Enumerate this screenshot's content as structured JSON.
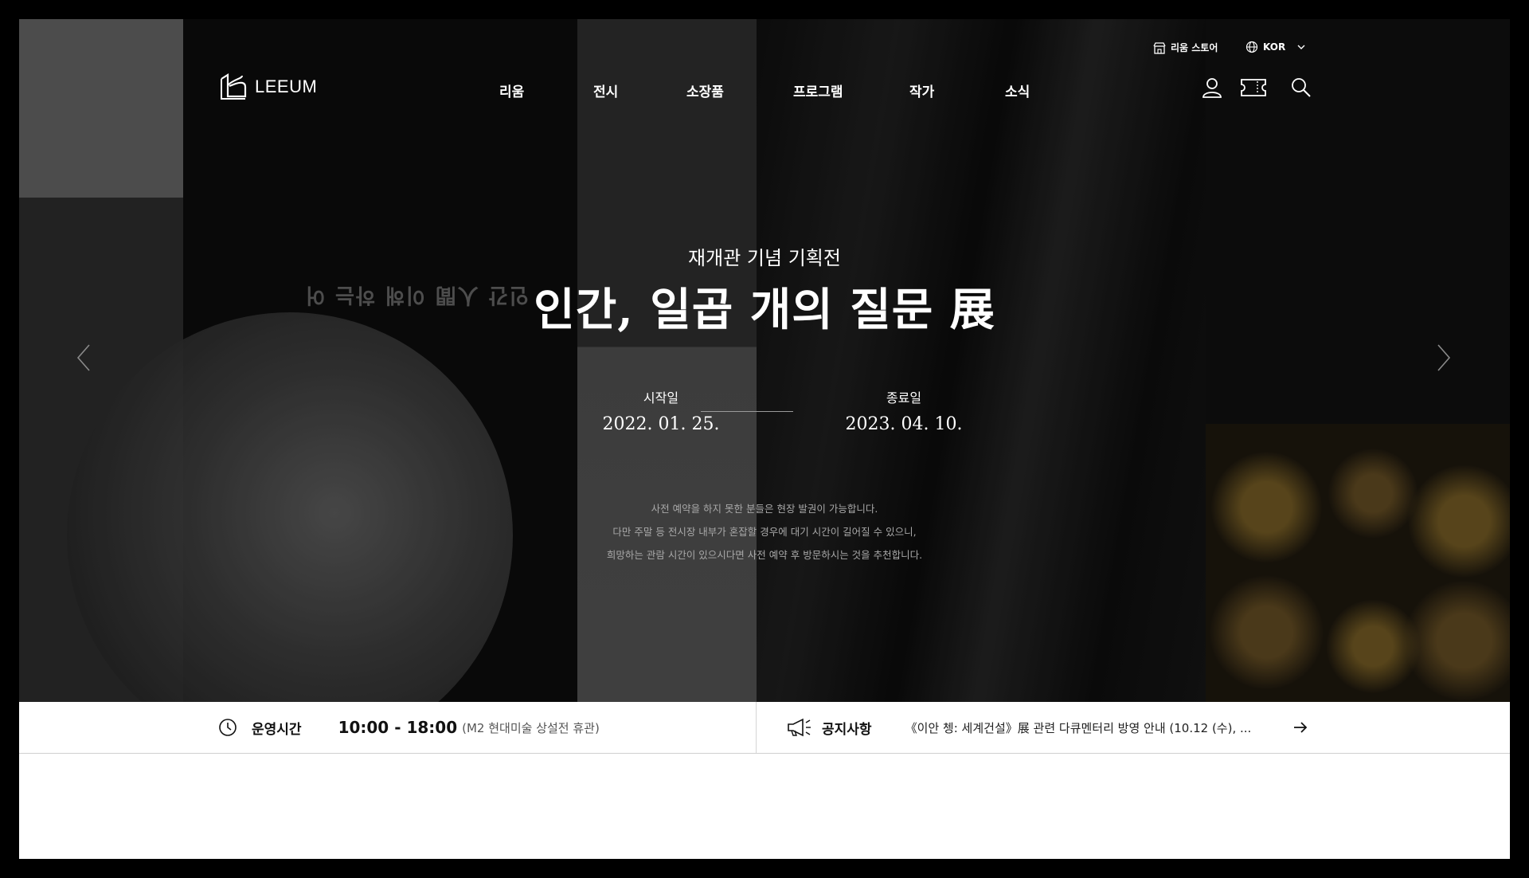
{
  "brand": {
    "logo_text": "LEEUM"
  },
  "nav": {
    "items": [
      "리움",
      "전시",
      "소장품",
      "프로그램",
      "작가",
      "소식"
    ]
  },
  "utility": {
    "store_label": "리움 스토어",
    "language": "KOR"
  },
  "hero": {
    "ghost_text": "인간 人間 이해 하는 어",
    "subtitle": "재개관 기념 기획전",
    "title": "인간, 일곱 개의 질문 展",
    "start_label": "시작일",
    "start_date": "2022. 01. 25.",
    "end_label": "종료일",
    "end_date": "2023. 04. 10.",
    "notice_lines": [
      "사전 예약을 하지 못한 분들은 현장 발권이 가능합니다.",
      "다만 주말 등 전시장 내부가 혼잡할 경우에 대기 시간이 길어질 수 있으니,",
      "희망하는 관람 시간이 있으시다면 사전 예약 후 방문하시는 것을 추천합니다."
    ]
  },
  "info": {
    "hours_label": "운영시간",
    "hours_value": "10:00 - 18:00",
    "hours_note": "(M2 현대미술 상설전 휴관)",
    "notice_label": "공지사항",
    "notice_text": "《이안 쳉: 세계건설》展 관련 다큐멘터리 방영 안내 (10.12 (수), ..."
  }
}
